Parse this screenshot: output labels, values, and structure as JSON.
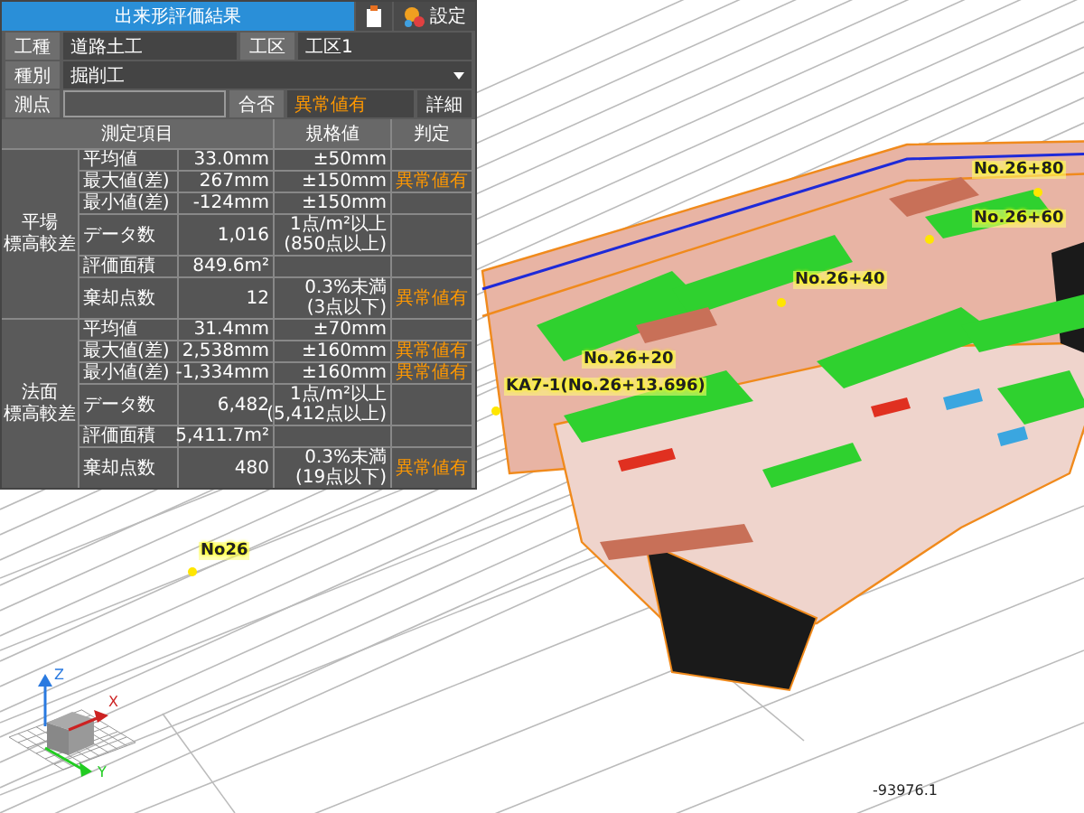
{
  "panel": {
    "title": "出来形評価結果",
    "settings_label": "設定",
    "fields": {
      "work_type_label": "工種",
      "work_type": "道路土工",
      "section_label": "工区",
      "section": "工区1",
      "category_label": "種別",
      "category": "掘削工",
      "station_label": "測点",
      "pass_label": "合否",
      "pass_value": "異常値有",
      "detail_button": "詳細"
    },
    "table": {
      "columns": [
        "測定項目",
        "規格値",
        "判定"
      ],
      "groups": [
        {
          "label": [
            "平場",
            "標高較差"
          ],
          "rows": [
            {
              "item": "平均値",
              "value": "33.0mm",
              "spec": "±50mm"
            },
            {
              "item": "最大値(差)",
              "value": "267mm",
              "spec": "±150mm",
              "judgement": "異常値有"
            },
            {
              "item": "最小値(差)",
              "value": "-124mm",
              "spec": "±150mm"
            },
            {
              "item": "データ数",
              "value": "1,016",
              "spec": "1点/m²以上\n(850点以上)"
            },
            {
              "item": "評価面積",
              "value": "849.6m²"
            },
            {
              "item": "棄却点数",
              "value": "12",
              "spec": "0.3%未満\n(3点以下)",
              "judgement": "異常値有"
            }
          ]
        },
        {
          "label": [
            "法面",
            "標高較差"
          ],
          "rows": [
            {
              "item": "平均値",
              "value": "31.4mm",
              "spec": "±70mm"
            },
            {
              "item": "最大値(差)",
              "value": "2,538mm",
              "spec": "±160mm",
              "judgement": "異常値有"
            },
            {
              "item": "最小値(差)",
              "value": "-1,334mm",
              "spec": "±160mm",
              "judgement": "異常値有"
            },
            {
              "item": "データ数",
              "value": "6,482",
              "spec": "1点/m²以上\n(5,412点以上)"
            },
            {
              "item": "評価面積",
              "value": "5,411.7m²"
            },
            {
              "item": "棄却点数",
              "value": "480",
              "spec": "0.3%未満\n(19点以下)",
              "judgement": "異常値有"
            }
          ]
        }
      ]
    }
  },
  "stations": [
    "No.26+80",
    "No.26+60",
    "No.26+40",
    "No.26+20",
    "KA7-1(No.26+13.696)",
    "No26"
  ],
  "axes": {
    "x": "X",
    "y": "Y",
    "z": "Z"
  },
  "coordinate": "-93976.1"
}
